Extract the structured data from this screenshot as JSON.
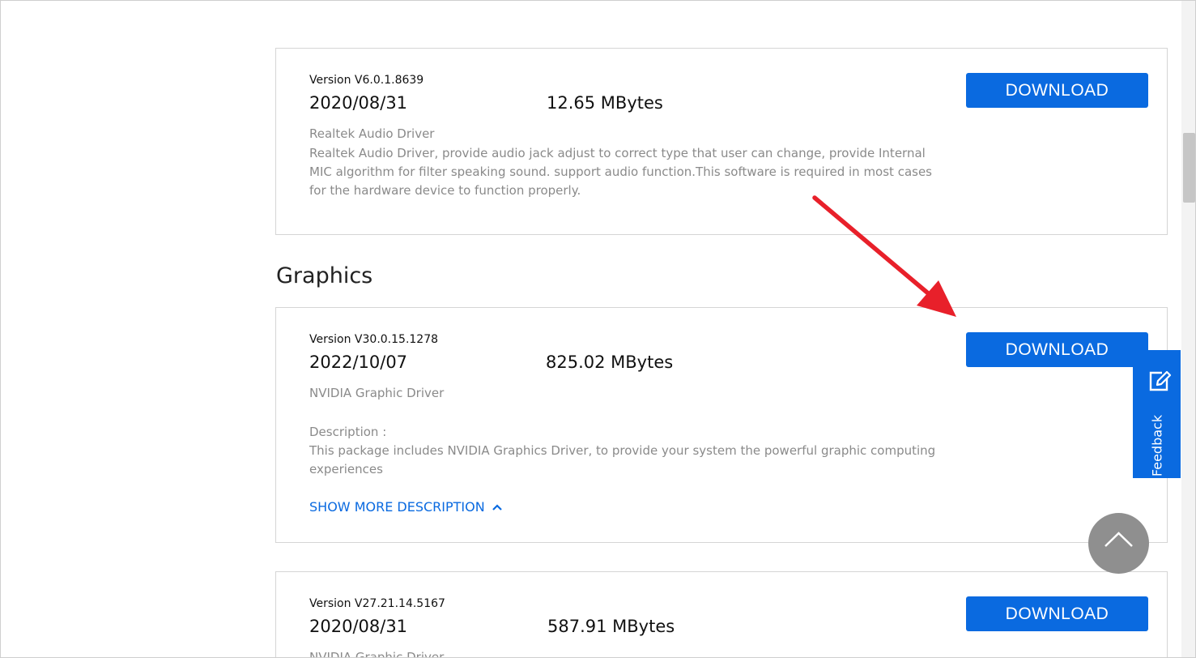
{
  "drivers_top": {
    "version": "Version V6.0.1.8639",
    "date": "2020/08/31",
    "size": "12.65 MBytes",
    "name": "Realtek Audio Driver",
    "description_lines": [
      "Realtek Audio Driver, provide audio jack adjust to correct type that user can change, provide Internal",
      "MIC algorithm for filter speaking sound. support audio function.This software is required in most cases",
      "for the hardware device to function properly."
    ],
    "download_label": "DOWNLOAD"
  },
  "graphics": {
    "heading": "Graphics",
    "items": [
      {
        "version": "Version V30.0.15.1278",
        "date": "2022/10/07",
        "size": "825.02 MBytes",
        "name": "NVIDIA Graphic Driver",
        "description_label": "Description :",
        "description_lines": [
          "This package includes NVIDIA Graphics Driver, to provide your system the powerful graphic computing",
          "experiences"
        ],
        "show_more_label": "SHOW MORE DESCRIPTION",
        "download_label": "DOWNLOAD"
      },
      {
        "version": "Version V27.21.14.5167",
        "date": "2020/08/31",
        "size": "587.91 MBytes",
        "name": "NVIDIA Graphic Driver",
        "download_label": "DOWNLOAD"
      }
    ]
  },
  "feedback_label": "Feedback",
  "colors": {
    "accent": "#0a6ae0",
    "annotation_arrow": "#e8202a",
    "back_to_top": "#8f8f8f"
  },
  "icons": {
    "feedback": "edit-icon",
    "back_to_top": "chevron-up-icon",
    "show_more": "chevron-up-icon"
  }
}
